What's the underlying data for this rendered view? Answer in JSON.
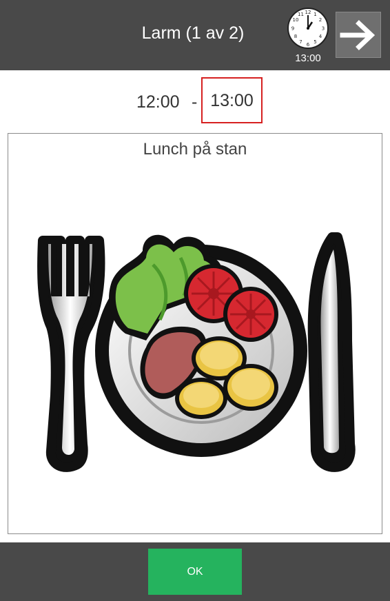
{
  "header": {
    "title": "Larm (1 av 2)",
    "clock_time": "13:00",
    "clock_icon": "analog-clock-icon",
    "next_icon": "arrow-right-icon"
  },
  "alarm": {
    "start_time": "12:00",
    "separator": "-",
    "end_time": "13:00"
  },
  "card": {
    "title": "Lunch på stan",
    "pictogram": "lunch-plate-pictogram"
  },
  "footer": {
    "ok_label": "OK"
  },
  "colors": {
    "header_bg": "#494949",
    "ok_green": "#25b35e",
    "highlight_red": "#d62020"
  }
}
